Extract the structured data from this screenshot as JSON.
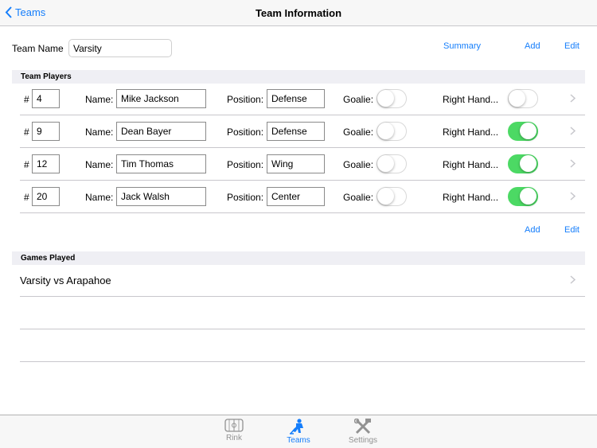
{
  "nav": {
    "back_label": "Teams",
    "title": "Team Information"
  },
  "team": {
    "name_label": "Team Name",
    "name_value": "Varsity"
  },
  "actions_top": {
    "summary": "Summary",
    "add": "Add",
    "edit": "Edit"
  },
  "players_section": {
    "header": "Team Players"
  },
  "labels": {
    "number": "#",
    "name": "Name:",
    "position": "Position:",
    "goalie": "Goalie:",
    "right_handed": "Right Hand..."
  },
  "players": [
    {
      "number": "4",
      "name": "Mike Jackson",
      "position": "Defense",
      "goalie": false,
      "right_handed": false
    },
    {
      "number": "9",
      "name": "Dean Bayer",
      "position": "Defense",
      "goalie": false,
      "right_handed": true
    },
    {
      "number": "12",
      "name": "Tim Thomas",
      "position": "Wing",
      "goalie": false,
      "right_handed": true
    },
    {
      "number": "20",
      "name": "Jack Walsh",
      "position": "Center",
      "goalie": false,
      "right_handed": true
    }
  ],
  "actions_players": {
    "add": "Add",
    "edit": "Edit"
  },
  "games_section": {
    "header": "Games Played"
  },
  "games": [
    {
      "title": "Varsity vs Arapahoe"
    }
  ],
  "tabs": [
    {
      "label": "Rink",
      "icon": "rink-icon",
      "active": false
    },
    {
      "label": "Teams",
      "icon": "hockey-player-icon",
      "active": true
    },
    {
      "label": "Settings",
      "icon": "tools-icon",
      "active": false
    }
  ],
  "colors": {
    "accent": "#157efb",
    "toggle_on": "#4cd964",
    "section_bg": "#efeff4"
  }
}
